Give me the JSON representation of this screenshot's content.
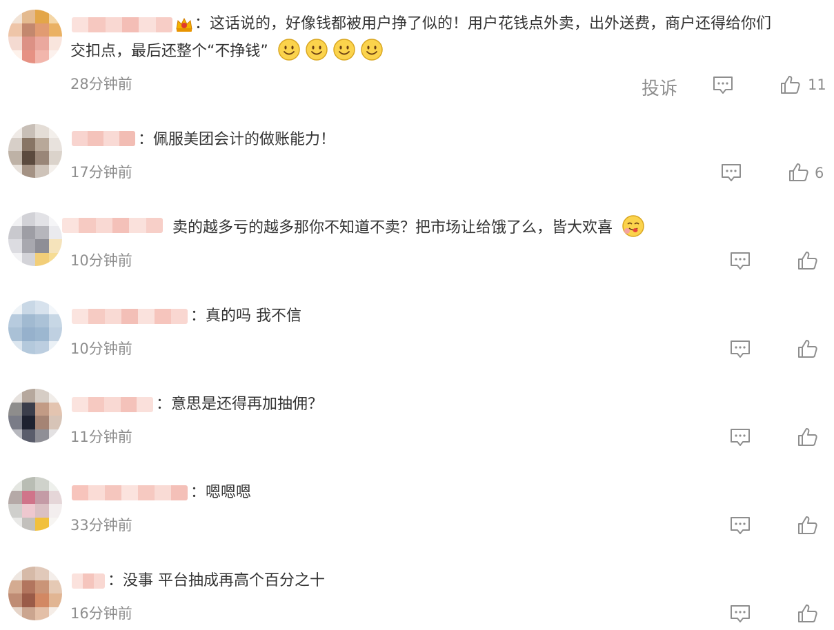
{
  "comments": [
    {
      "text_line1": "：这话说的，好像钱都被用户挣了似的！用户花钱点外卖，出外送费，商户还得给你们",
      "text_line2": "交扣点，最后还整个“不挣钱”",
      "time": "28分钟前",
      "report_label": "投诉",
      "likes": "11",
      "has_crown": true,
      "emoji_count": 4
    },
    {
      "text": "：佩服美团会计的做账能力！",
      "time": "17分钟前",
      "likes": "6"
    },
    {
      "text": "卖的越多亏的越多那你不知道不卖？把市场让给饿了么，皆大欢喜",
      "time": "10分钟前",
      "likes": ""
    },
    {
      "text": "：真的吗 我不信",
      "time": "10分钟前",
      "likes": ""
    },
    {
      "text": "：意思是还得再加抽佣？",
      "time": "11分钟前",
      "likes": ""
    },
    {
      "text": "：嗯嗯嗯",
      "time": "33分钟前",
      "likes": ""
    },
    {
      "text": "：没事 平台抽成再高个百分之十",
      "time": "16分钟前",
      "likes": ""
    }
  ],
  "colors": {
    "text": "#333333",
    "meta": "#8e8e8e",
    "blur_pink": "#f6c9c3",
    "emoji_yellow": "#fbd34c"
  },
  "icons": {
    "reply": "comment-bubble-icon",
    "like": "thumbs-up-icon",
    "emoji": "smile-emoji-icon",
    "crown": "crown-badge-icon"
  }
}
